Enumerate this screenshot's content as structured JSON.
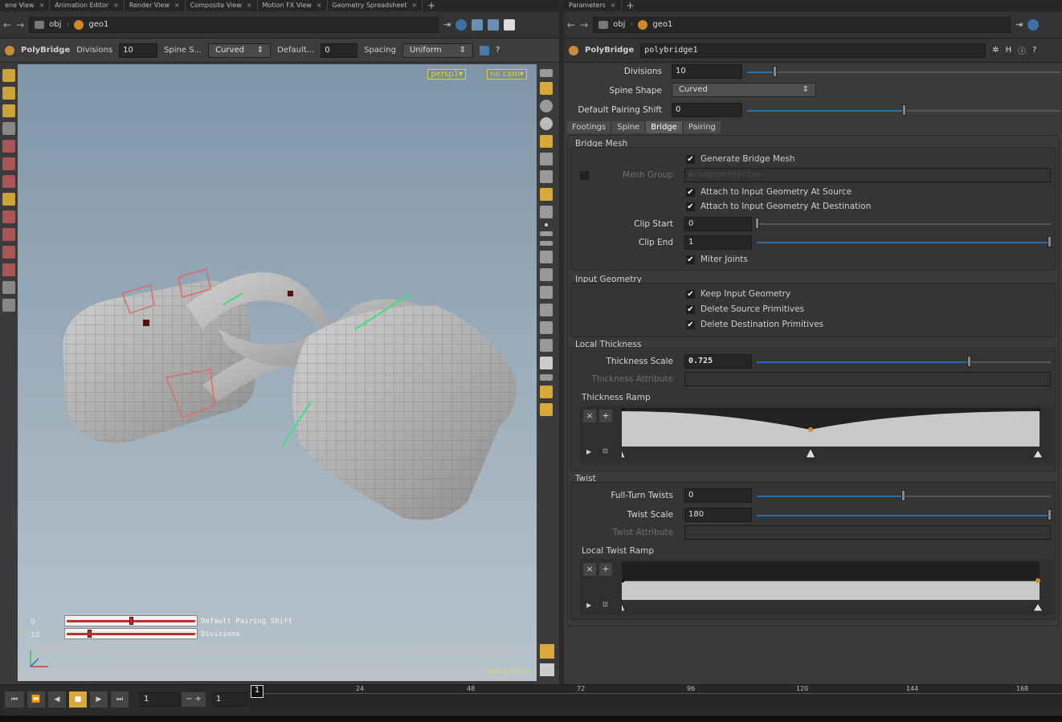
{
  "left_tabs": [
    "ene View",
    "Animation Editor",
    "Render View",
    "Composite View",
    "Motion FX View",
    "Geometry Spreadsheet"
  ],
  "right_tabs": [
    "Parameters"
  ],
  "path": {
    "obj": "obj",
    "geo": "geo1"
  },
  "opbar": {
    "node": "PolyBridge",
    "div_label": "Divisions",
    "div_val": "10",
    "spine_label": "Spine S...",
    "spine_val": "Curved",
    "default_label": "Default...",
    "default_val": "0",
    "spacing_label": "Spacing",
    "spacing_val": "Uniform"
  },
  "viewport": {
    "cam1": "persp1▾",
    "cam2": "no cam▾",
    "edition": "Indie Edition",
    "hud_rows": [
      {
        "value": "0",
        "label": "Default Pairing Shift"
      },
      {
        "value": "10",
        "label": "Divisions"
      }
    ]
  },
  "params": {
    "node_type": "PolyBridge",
    "node_name": "polybridge1",
    "divisions_label": "Divisions",
    "divisions": "10",
    "spine_label": "Spine Shape",
    "spine": "Curved",
    "pairing_label": "Default Pairing Shift",
    "pairing": "0",
    "tabs": [
      "Footings",
      "Spine",
      "Bridge",
      "Pairing"
    ],
    "bridge_mesh": {
      "title": "Bridge Mesh",
      "generate": "Generate Bridge Mesh",
      "mesh_group_label": "Mesh Group",
      "mesh_group_val": "bridgemeshprims",
      "attach_src": "Attach to Input Geometry At Source",
      "attach_dst": "Attach to Input Geometry At Destination",
      "clip_start_label": "Clip Start",
      "clip_start": "0",
      "clip_end_label": "Clip End",
      "clip_end": "1",
      "miter": "Miter Joints"
    },
    "input_geo": {
      "title": "Input Geometry",
      "keep": "Keep Input Geometry",
      "del_src": "Delete Source Primitives",
      "del_dst": "Delete Destination Primitives"
    },
    "local_thickness": {
      "title": "Local Thickness",
      "scale_label": "Thickness Scale",
      "scale": "0.725",
      "attr_label": "Thickness Attribute",
      "ramp_label": "Thickness Ramp"
    },
    "twist": {
      "title": "Twist",
      "full_label": "Full-Turn Twists",
      "full": "0",
      "scale_label": "Twist Scale",
      "scale": "180",
      "attr_label": "Twist Attribute",
      "ramp_label": "Local Twist Ramp"
    }
  },
  "timeline": {
    "frame": "1",
    "start": "1",
    "end": "1",
    "ticks": [
      "1",
      "24",
      "48",
      "72",
      "96",
      "120",
      "144",
      "168"
    ]
  }
}
